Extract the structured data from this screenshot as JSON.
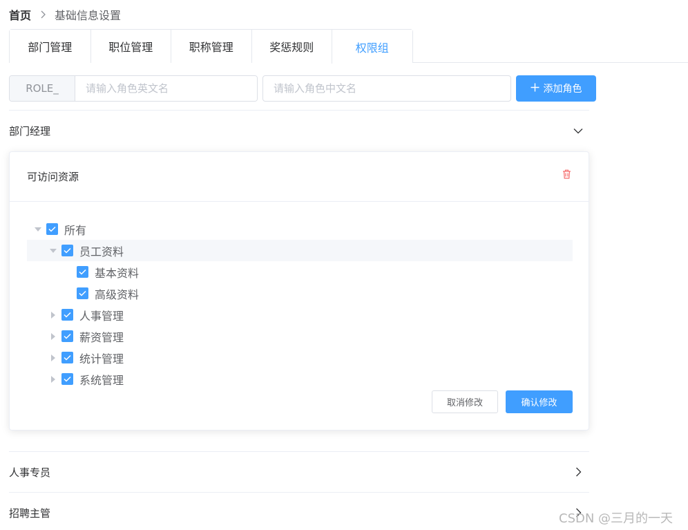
{
  "breadcrumb": {
    "home": "首页",
    "current": "基础信息设置"
  },
  "tabs": [
    "部门管理",
    "职位管理",
    "职称管理",
    "奖惩规则",
    "权限组"
  ],
  "active_tab": "权限组",
  "role_form": {
    "prefix": "ROLE_",
    "en_placeholder": "请输入角色英文名",
    "cn_placeholder": "请输入角色中文名",
    "add_label": "添加角色"
  },
  "roles": [
    "部门经理",
    "人事专员",
    "招聘主管"
  ],
  "card": {
    "title": "可访问资源",
    "tree": {
      "root": "所有",
      "nodes": [
        "员工资料",
        "基本资料",
        "高级资料",
        "人事管理",
        "薪资管理",
        "统计管理",
        "系统管理"
      ]
    },
    "cancel_label": "取消修改",
    "confirm_label": "确认修改"
  },
  "watermark": "CSDN @三月的一天",
  "colors": {
    "primary": "#409eff",
    "danger": "#f56c6c",
    "border": "#dcdfe6"
  }
}
